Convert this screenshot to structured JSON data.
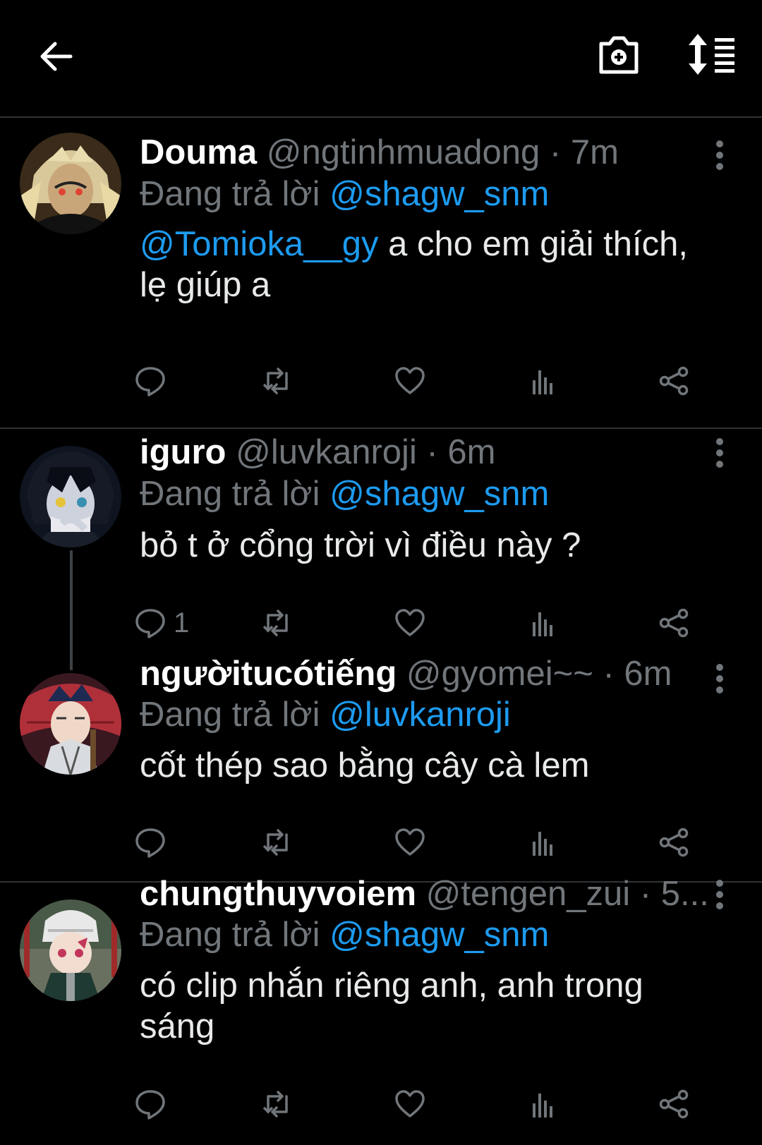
{
  "header": {
    "back_icon": "arrow-left-icon",
    "camera_icon": "camera-add-icon",
    "sort_icon": "sort-replies-icon"
  },
  "colors": {
    "accent": "#1d9bf0",
    "muted": "#71767b",
    "background": "#000000"
  },
  "tweets": [
    {
      "name": "Douma",
      "handle": "@ngtinhmuadong",
      "sep": "·",
      "time": "7m",
      "reply_prefix": "Đang trả lời",
      "reply_to": "@shagw_snm",
      "body_mention": "@Tomioka__gy",
      "body_text": " a cho em giải thích, lẹ giúp a",
      "reply_count": ""
    },
    {
      "name": "iguro",
      "handle": "@luvkanroji",
      "sep": "·",
      "time": "6m",
      "reply_prefix": "Đang trả lời",
      "reply_to": "@shagw_snm",
      "body_text": "bỏ t ở cổng trời vì điều này ?",
      "reply_count": "1"
    },
    {
      "name": "ngườitucótiếng",
      "handle": "@gyomei~~",
      "sep": "·",
      "time": "6m",
      "reply_prefix": "Đang trả lời",
      "reply_to": "@luvkanroji",
      "body_text": "cốt thép sao bằng cây cà lem",
      "reply_count": ""
    },
    {
      "name": "chungthuyvoiem",
      "handle": "@tengen_zui",
      "sep": "·",
      "time": "5...",
      "reply_prefix": "Đang trả lời",
      "reply_to": "@shagw_snm",
      "body_text": "có clip nhắn riêng anh, anh trong sáng",
      "reply_count": ""
    }
  ]
}
